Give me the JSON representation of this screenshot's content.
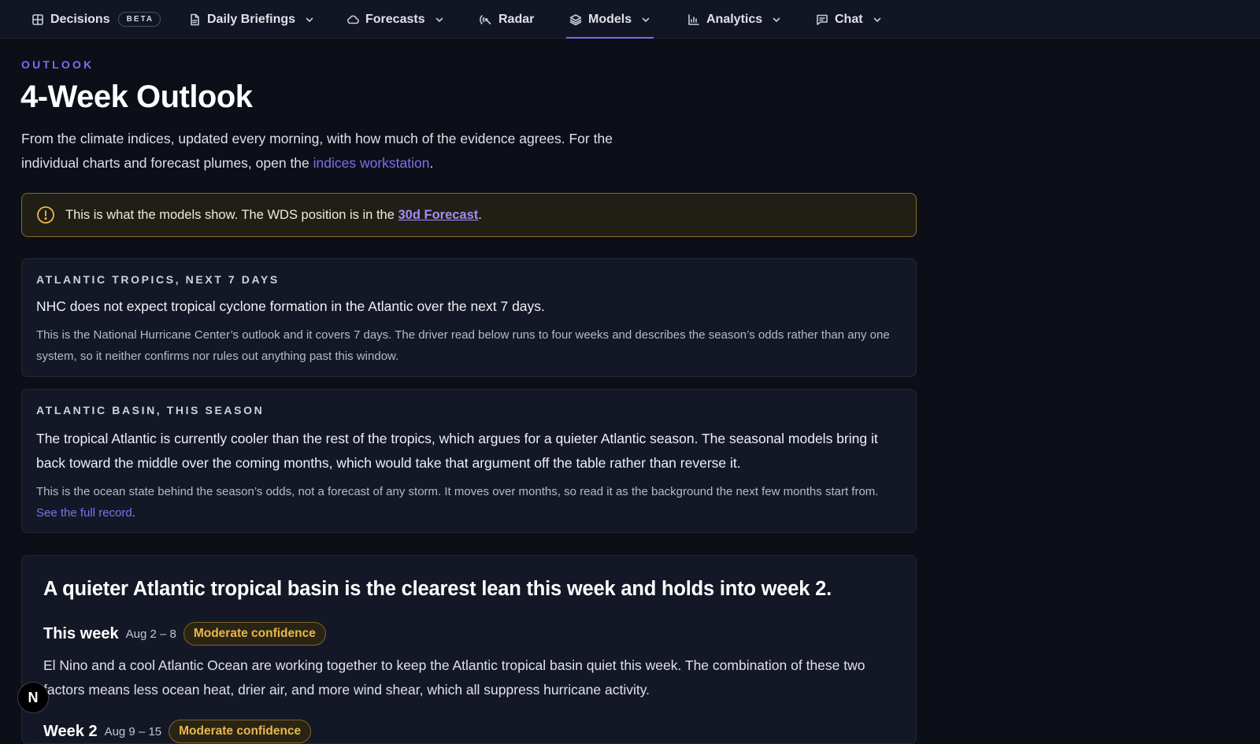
{
  "nav": {
    "decisions": {
      "label": "Decisions",
      "badge": "BETA",
      "icon": "grid-icon"
    },
    "briefings": {
      "label": "Daily Briefings",
      "icon": "document-icon"
    },
    "forecasts": {
      "label": "Forecasts",
      "icon": "cloud-icon"
    },
    "radar": {
      "label": "Radar",
      "icon": "radar-icon"
    },
    "models": {
      "label": "Models",
      "icon": "layers-icon",
      "active": true
    },
    "analytics": {
      "label": "Analytics",
      "icon": "bar-chart-icon"
    },
    "chat": {
      "label": "Chat",
      "icon": "chat-icon"
    }
  },
  "page": {
    "eyebrow": "OUTLOOK",
    "title": "4-Week Outlook",
    "intro_before": "From the climate indices, updated every morning, with how much of the evidence agrees. For the individual charts and forecast plumes, open the ",
    "intro_link": "indices workstation",
    "intro_after": "."
  },
  "alert": {
    "text_before": "This is what the models show. The WDS position is in the ",
    "link": "30d Forecast",
    "text_after": ".",
    "accent": "#e8b84a"
  },
  "cards": [
    {
      "label": "ATLANTIC TROPICS, NEXT 7 DAYS",
      "headline": "NHC does not expect tropical cyclone formation in the Atlantic over the next 7 days.",
      "body": "This is the National Hurricane Center’s outlook and it covers 7 days. The driver read below runs to four weeks and describes the season’s odds rather than any one system, so it neither confirms nor rules out anything past this window."
    },
    {
      "label": "ATLANTIC BASIN, THIS SEASON",
      "headline": "The tropical Atlantic is currently cooler than the rest of the tropics, which argues for a quieter Atlantic season. The seasonal models bring it back toward the middle over the coming months, which would take that argument off the table rather than reverse it.",
      "body_before": "This is the ocean state behind the season’s odds, not a forecast of any storm. It moves over months, so read it as the background the next few months start from. ",
      "body_link": "See the full record",
      "body_after": "."
    }
  ],
  "outlook": {
    "headline": "A quieter Atlantic tropical basin is the clearest lean this week and holds into week 2.",
    "weeks": [
      {
        "name": "This week",
        "dates": "Aug 2 – 8",
        "confidence": "Moderate confidence",
        "text": "El Nino and a cool Atlantic Ocean are working together to keep the Atlantic tropical basin quiet this week. The combination of these two factors means less ocean heat, drier air, and more wind shear, which all suppress hurricane activity."
      },
      {
        "name": "Week 2",
        "dates": "Aug 9 – 15",
        "confidence": "Moderate confidence"
      }
    ]
  },
  "fab": {
    "letter": "N"
  },
  "colors": {
    "accent": "#7c6cf2",
    "background": "#0c0e18",
    "warning": "#e8b84a"
  }
}
